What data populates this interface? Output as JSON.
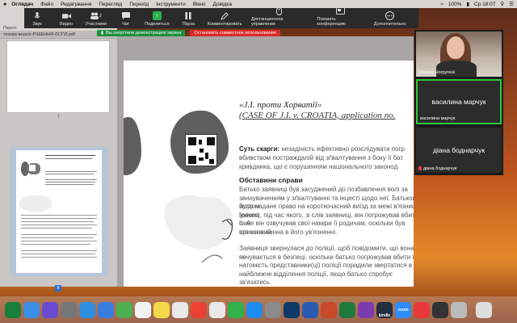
{
  "menubar": {
    "app": "Оглядач",
    "items": [
      "Файл",
      "Редагування",
      "Перегляд",
      "Перехід",
      "Інструменти",
      "Вікно",
      "Довідка"
    ],
    "battery": "100%",
    "clock": "Ср 18:07"
  },
  "toolbar": {
    "buttons": [
      {
        "label": "Звук",
        "icon": "mic-icon"
      },
      {
        "label": "Видео",
        "icon": "video-icon"
      },
      {
        "label": "Участники",
        "icon": "participants-icon",
        "count": "3"
      },
      {
        "label": "Чат",
        "icon": "chat-icon"
      },
      {
        "label": "Поделиться",
        "icon": "share-icon"
      },
      {
        "label": "Пауза",
        "icon": "pause-icon"
      },
      {
        "label": "Комментировать",
        "icon": "annotate-icon"
      },
      {
        "label": "Дистанционное управление",
        "icon": "remote-control-icon"
      },
      {
        "label": "Показать конференцию",
        "icon": "show-conference-icon"
      },
      {
        "label": "Дополнительно",
        "icon": "more-icon"
      }
    ]
  },
  "sharebar": {
    "notice": "Вы запустили демонстрацию экрана",
    "stop": "Остановить совместное использование"
  },
  "sidebar": {
    "tabs_label": "Перегл",
    "file_name": "тезова-версія-РІШЕННЯ-ЄСПЛ.pdf",
    "page_number": "7",
    "selected_page": "8"
  },
  "document": {
    "title": "«J.I. проти Хорватії»",
    "subtitle": "(CASE OF J.I. v. CROATIA, application no.",
    "complaint_label": "Суть скарги:",
    "complaint_lines": [
      "Суть скарги: незадіність ефективно розслідувати погр",
      "вбивством постраждалій від зґвалтування з боку її бат",
      "кривдника, що є порушенням національного законод"
    ],
    "section_heading": "Обставини справи",
    "paragraph1": [
      "Батько заявниці був засуджений до позбавлення волі за",
      "звинуваченням у зґвалтуванні та інцесті щодо неї. Батькові згодом",
      "було надане право на короткочасний виїзд за межі в'язниці (prison",
      "leaves), під час якого, зі слів заявниці, він погрожував вбити її. А",
      "саме він озвучував свої наміри її родичам, оскільки був впевнений,",
      "що вона винна в його ув'язненні."
    ],
    "paragraph2": [
      "Заявниця звернулася до поліції, щоб повідомити, що вона не",
      "почувається в безпеці, оскільки батько погрожував вбити її,",
      "натомість представники(ці) поліції порадили звертатися в",
      "найближче відділення поліції, якщо батько спробує зв'язатись"
    ]
  },
  "participants": [
    {
      "name": "Oksana Horpyniuk",
      "type": "video"
    },
    {
      "name": "василина марчук",
      "display": "василина марчук",
      "active": true
    },
    {
      "name": "діана боднарчук",
      "display": "діана боднарчук",
      "muted": true
    }
  ],
  "dock": {
    "apps": [
      {
        "icon": "zoom-pen-icon",
        "color": "#1a7f3a"
      },
      {
        "icon": "finder-icon",
        "color": "#3a8ee6"
      },
      {
        "icon": "siri-icon",
        "color": "#6a4ad0"
      },
      {
        "icon": "launchpad-icon",
        "color": "#777777"
      },
      {
        "icon": "safari-icon",
        "color": "#2f8ee0"
      },
      {
        "icon": "mail-icon",
        "color": "#3a7be0"
      },
      {
        "icon": "maps-icon",
        "color": "#4caf50"
      },
      {
        "icon": "calendar-icon",
        "color": "#f2f2f2"
      },
      {
        "icon": "notes-icon",
        "color": "#f5d84a"
      },
      {
        "icon": "photos-icon",
        "color": "#e8e8e8"
      },
      {
        "icon": "chrome-icon",
        "color": "#e94235"
      },
      {
        "icon": "reminders-icon",
        "color": "#e8e8e8"
      },
      {
        "icon": "facetime-icon",
        "color": "#2fb24a"
      },
      {
        "icon": "appstore-icon",
        "color": "#1d8cf0"
      },
      {
        "icon": "preferences-icon",
        "color": "#8a8a8a"
      },
      {
        "icon": "photoshop-icon",
        "color": "#0b3b66"
      },
      {
        "icon": "word-icon",
        "color": "#2a5bb0"
      },
      {
        "icon": "powerpoint-icon",
        "color": "#c84a2a"
      },
      {
        "icon": "excel-icon",
        "color": "#1f7a3d"
      },
      {
        "icon": "onenote-icon",
        "color": "#7b3bb0"
      },
      {
        "icon": "kindle-icon",
        "color": "#232f3e"
      },
      {
        "icon": "zoom-icon",
        "color": "#2d8cff"
      },
      {
        "icon": "youtube-icon",
        "color": "#e83a3a"
      },
      {
        "icon": "music-icon",
        "color": "#333333"
      },
      {
        "icon": "downloads-icon",
        "color": "#bbbbbb"
      },
      {
        "icon": "trash-icon",
        "color": "#dddddd"
      }
    ],
    "kindle_label": "kindle",
    "zoom_label": "zoom"
  }
}
